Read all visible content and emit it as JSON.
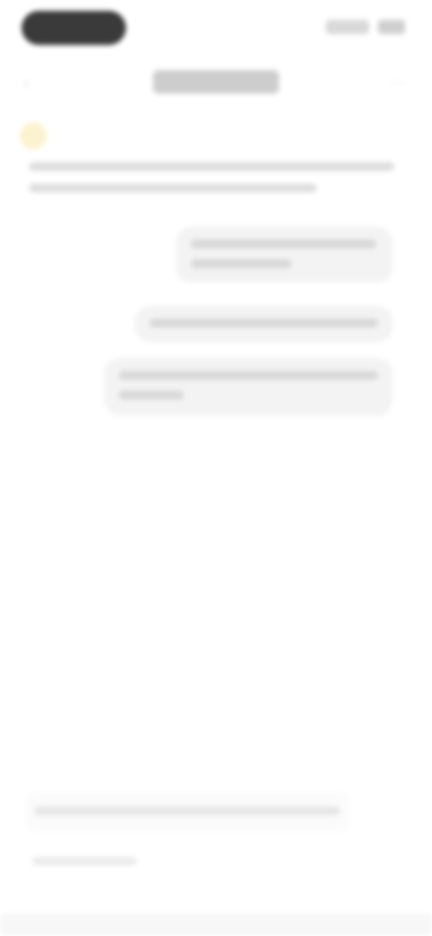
{
  "status_bar": {
    "pill_icon": "status-pill",
    "signal_icon": "signal-icon",
    "battery_icon": "battery-icon"
  },
  "nav": {
    "back_icon": "chevron-left-icon",
    "more_icon": "more-icon",
    "title": ""
  },
  "conversation": {
    "assistant_avatar_icon": "assistant-avatar-icon",
    "assistant_text": "",
    "user_messages": [
      "",
      "",
      ""
    ]
  },
  "bottom": {
    "card_text": "",
    "small_text": ""
  },
  "colors": {
    "background": "#ffffff",
    "pill": "#3a3a3a",
    "bubble": "#f3f3f3",
    "avatar": "#fbf2cf"
  }
}
